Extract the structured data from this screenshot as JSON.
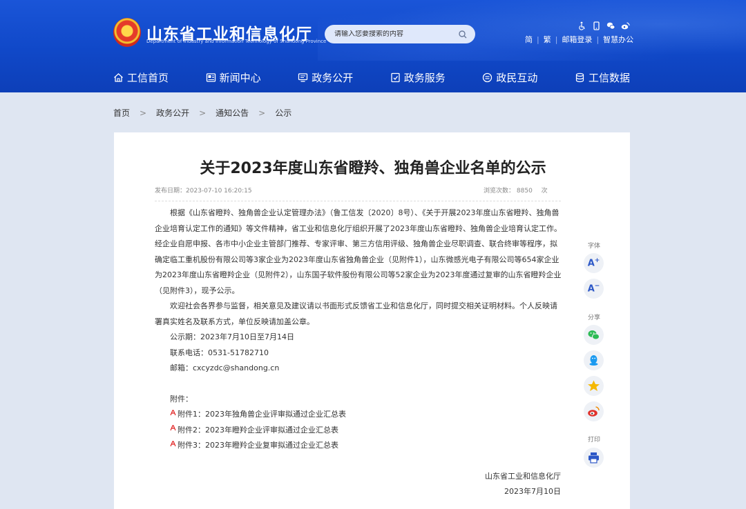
{
  "header": {
    "site_title": "山东省工业和信息化厅",
    "site_subtitle": "Department of Industry and Information Technology of Shandong Province",
    "search_placeholder": "请输入您要搜索的内容",
    "util_links": [
      "简",
      "繁",
      "邮箱登录",
      "智慧办公"
    ]
  },
  "nav": [
    {
      "label": "工信首页",
      "icon": "home-icon"
    },
    {
      "label": "新闻中心",
      "icon": "news-icon"
    },
    {
      "label": "政务公开",
      "icon": "monitor-icon"
    },
    {
      "label": "政务服务",
      "icon": "service-icon"
    },
    {
      "label": "政民互动",
      "icon": "chat-icon"
    },
    {
      "label": "工信数据",
      "icon": "database-icon"
    }
  ],
  "breadcrumb": [
    "首页",
    "政务公开",
    "通知公告",
    "公示"
  ],
  "article": {
    "title": "关于2023年度山东省瞪羚、独角兽企业名单的公示",
    "publish_label": "发布日期：",
    "publish_date": "2023-07-10 16:20:15",
    "views_label": "浏览次数：",
    "views": "8850",
    "views_unit": "次",
    "para1": "根据《山东省瞪羚、独角兽企业认定管理办法》（鲁工信发〔2020〕8号）、《关于开展2023年度山东省瞪羚、独角兽企业培育认定工作的通知》等文件精神，省工业和信息化厅组织开展了2023年度山东省瞪羚、独角兽企业培育认定工作。经企业自愿申报、各市中小企业主管部门推荐、专家评审、第三方信用评级、独角兽企业尽职调查、联合终审等程序，拟确定临工重机股份有限公司等3家企业为2023年度山东省独角兽企业（见附件1），山东微感光电子有限公司等654家企业为2023年度山东省瞪羚企业（见附件2），山东国子软件股份有限公司等52家企业为2023年度通过复审的山东省瞪羚企业（见附件3），现予公示。",
    "para2": "欢迎社会各界参与监督，相关意见及建议请以书面形式反馈省工业和信息化厅，同时提交相关证明材料。个人反映请署真实姓名及联系方式，单位反映请加盖公章。",
    "period": "公示期：2023年7月10日至7月14日",
    "phone": "联系电话：0531-51782710",
    "email": "邮箱：cxcyzdc@shandong.cn",
    "attach_label": "附件：",
    "attachments": [
      "附件1：2023年独角兽企业评审拟通过企业汇总表",
      "附件2：2023年瞪羚企业评审拟通过企业汇总表",
      "附件3：2023年瞪羚企业复审拟通过企业汇总表"
    ],
    "signature": "山东省工业和信息化厅",
    "sign_date": "2023年7月10日"
  },
  "sidebar": {
    "font_label": "字体",
    "font_up": "A",
    "font_up_sign": "+",
    "font_down": "A",
    "font_down_sign": "−",
    "share_label": "分享",
    "print_label": "打印"
  },
  "colors": {
    "header_blue": "#1048c8",
    "page_bg": "#dfe6f2",
    "wechat_green": "#2dbb55",
    "qq_blue": "#1a9af0",
    "qzone_yellow": "#f5b800",
    "weibo_red": "#e0302a",
    "pdf_red": "#e02020"
  }
}
